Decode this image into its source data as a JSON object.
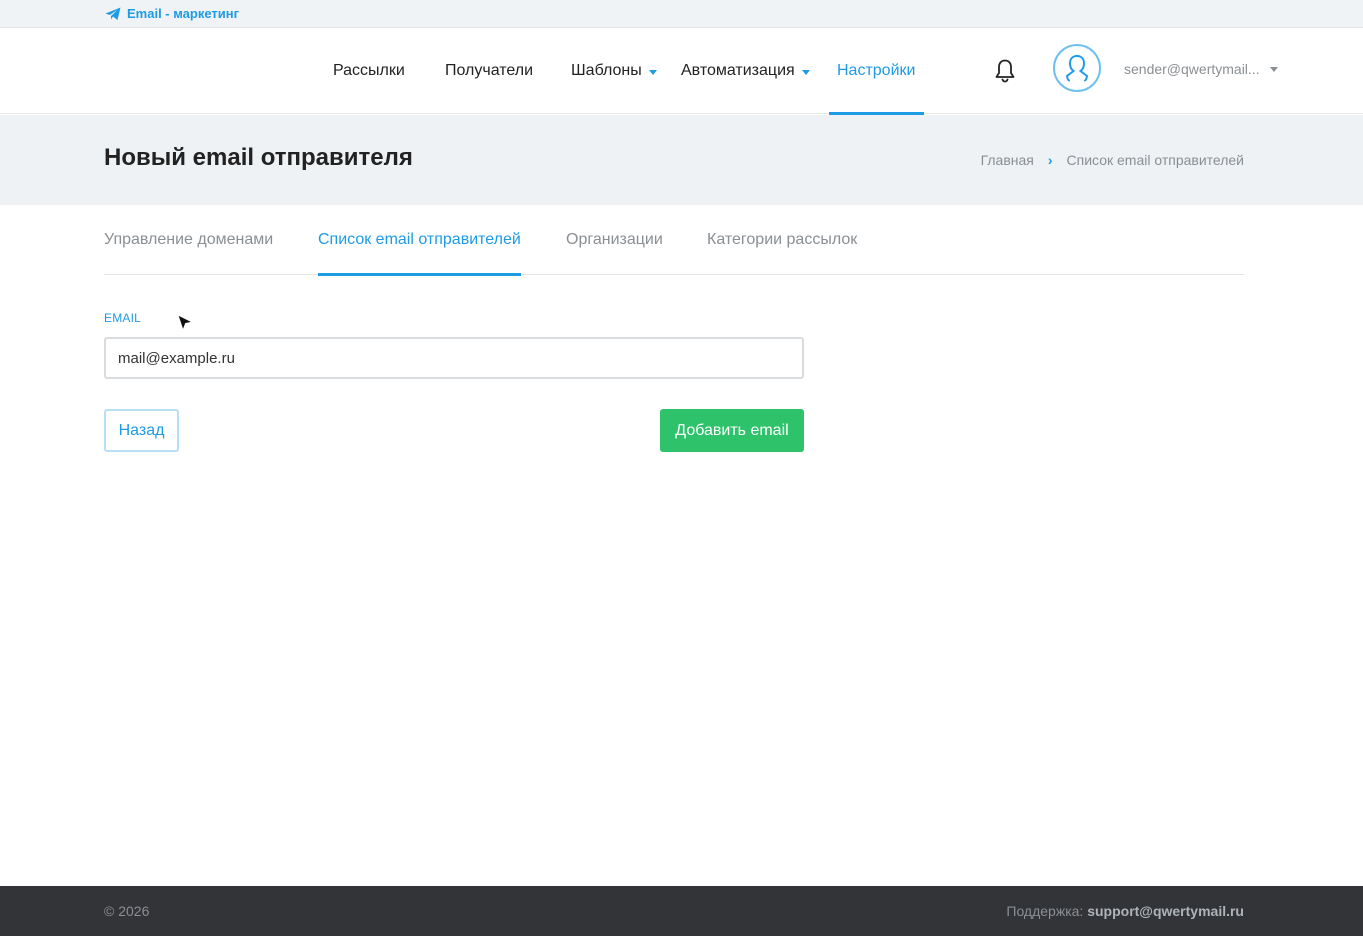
{
  "brand": {
    "label": "Email - маркетинг",
    "icon": "paper-plane-icon"
  },
  "nav": {
    "items": [
      {
        "label": "Рассылки"
      },
      {
        "label": "Получатели"
      },
      {
        "label": "Шаблоны"
      },
      {
        "label": "Автоматизация"
      },
      {
        "label": "Настройки"
      }
    ],
    "user_email": "sender@qwertymail..."
  },
  "page": {
    "title": "Новый email отправителя",
    "breadcrumb": [
      "Главная",
      "Список email отправителей"
    ]
  },
  "tabs": [
    {
      "label": "Управление доменами"
    },
    {
      "label": "Список email отправителей"
    },
    {
      "label": "Организации"
    },
    {
      "label": "Категории рассылок"
    }
  ],
  "form": {
    "email_label": "EMAIL",
    "email_value": "mail@example.ru",
    "back_label": "Назад",
    "submit_label": "Добавить email"
  },
  "footer": {
    "copyright": "© 2026",
    "support_label": "Поддержка:",
    "support_email": "support@qwertymail.ru"
  },
  "colors": {
    "accent": "#1e9be5",
    "success": "#2ec36b",
    "footer_bg": "#333437"
  }
}
